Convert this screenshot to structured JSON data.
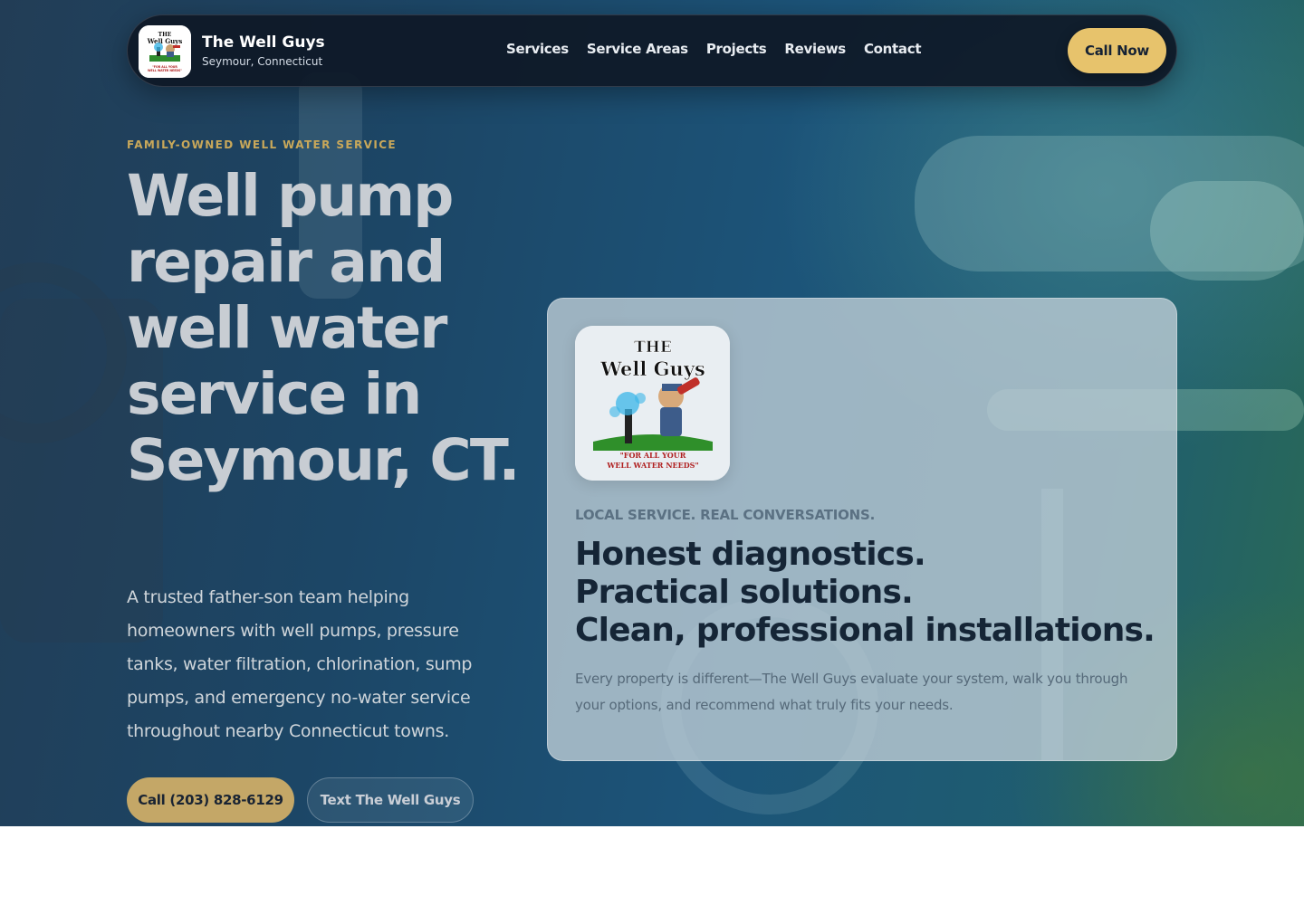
{
  "brand": {
    "name": "The Well Guys",
    "location": "Seymour, Connecticut",
    "logo": {
      "line1": "THE",
      "line2": "Well Guys",
      "tagline1": "\"FOR ALL YOUR",
      "tagline2": "WELL WATER NEEDS\""
    }
  },
  "nav": {
    "links": [
      "Services",
      "Service Areas",
      "Projects",
      "Reviews",
      "Contact"
    ],
    "cta": "Call Now"
  },
  "hero": {
    "eyebrow": "FAMILY-OWNED WELL WATER SERVICE",
    "headline": "Well pump repair and well water service in Seymour, CT.",
    "lead": "A trusted father-son team helping homeowners with well pumps, pressure tanks, water filtration, chlorination, sump pumps, and emergency no-water service throughout nearby Connecticut towns.",
    "primary_cta": "Call (203) 828-6129",
    "secondary_cta": "Text The Well Guys"
  },
  "card": {
    "eyebrow": "LOCAL SERVICE. REAL CONVERSATIONS.",
    "headline_lines": [
      "Honest diagnostics.",
      "Practical solutions.",
      "Clean, professional installations."
    ],
    "body": "Every property is different—The Well Guys evaluate your system, walk you through your options, and recommend what truly fits your needs."
  },
  "colors": {
    "accent": "#e7c36c",
    "nav_bg": "#0e1826",
    "eyebrow": "#c9a85a",
    "card_heading": "#152536"
  }
}
